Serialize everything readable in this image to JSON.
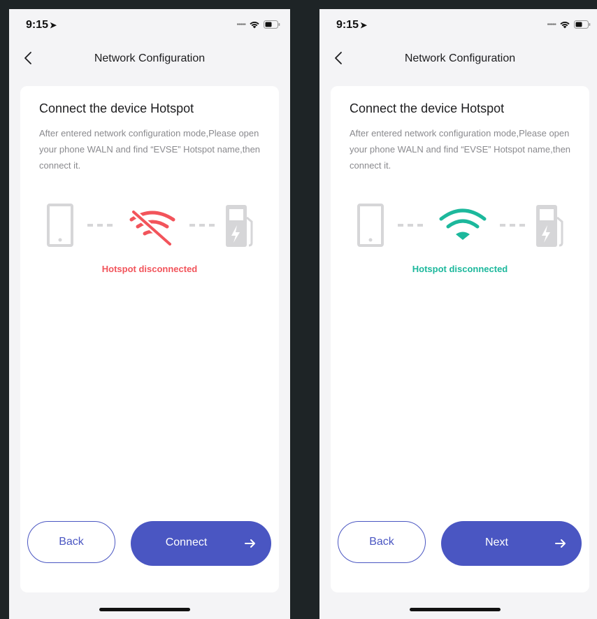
{
  "screens": [
    {
      "status_time": "9:15",
      "nav_title": "Network Configuration",
      "card_title": "Connect the device Hotspot",
      "description": "After entered network configuration mode,Please open your phone WALN and find “EVSE” Hotspot name,then connect it.",
      "diagram": {
        "phone_icon": "phone-icon",
        "wifi_icon": "wifi-off-icon",
        "charger_icon": "ev-charger-icon",
        "wifi_color": "#f2545b"
      },
      "hotspot_status": "Hotspot disconnected",
      "status_color": "#f2545b",
      "back_label": "Back",
      "primary_label": "Connect"
    },
    {
      "status_time": "9:15",
      "nav_title": "Network Configuration",
      "card_title": "Connect the device Hotspot",
      "description": "After entered network configuration mode,Please open your phone WALN and find “EVSE” Hotspot name,then connect it.",
      "diagram": {
        "phone_icon": "phone-icon",
        "wifi_icon": "wifi-icon",
        "charger_icon": "ev-charger-icon",
        "wifi_color": "#1cb89c"
      },
      "hotspot_status": "Hotspot disconnected",
      "status_color": "#1cb89c",
      "back_label": "Back",
      "primary_label": "Next"
    }
  ],
  "colors": {
    "accent": "#4a56c2",
    "icon_gray": "#d6d6d8",
    "background": "#1e2426"
  }
}
